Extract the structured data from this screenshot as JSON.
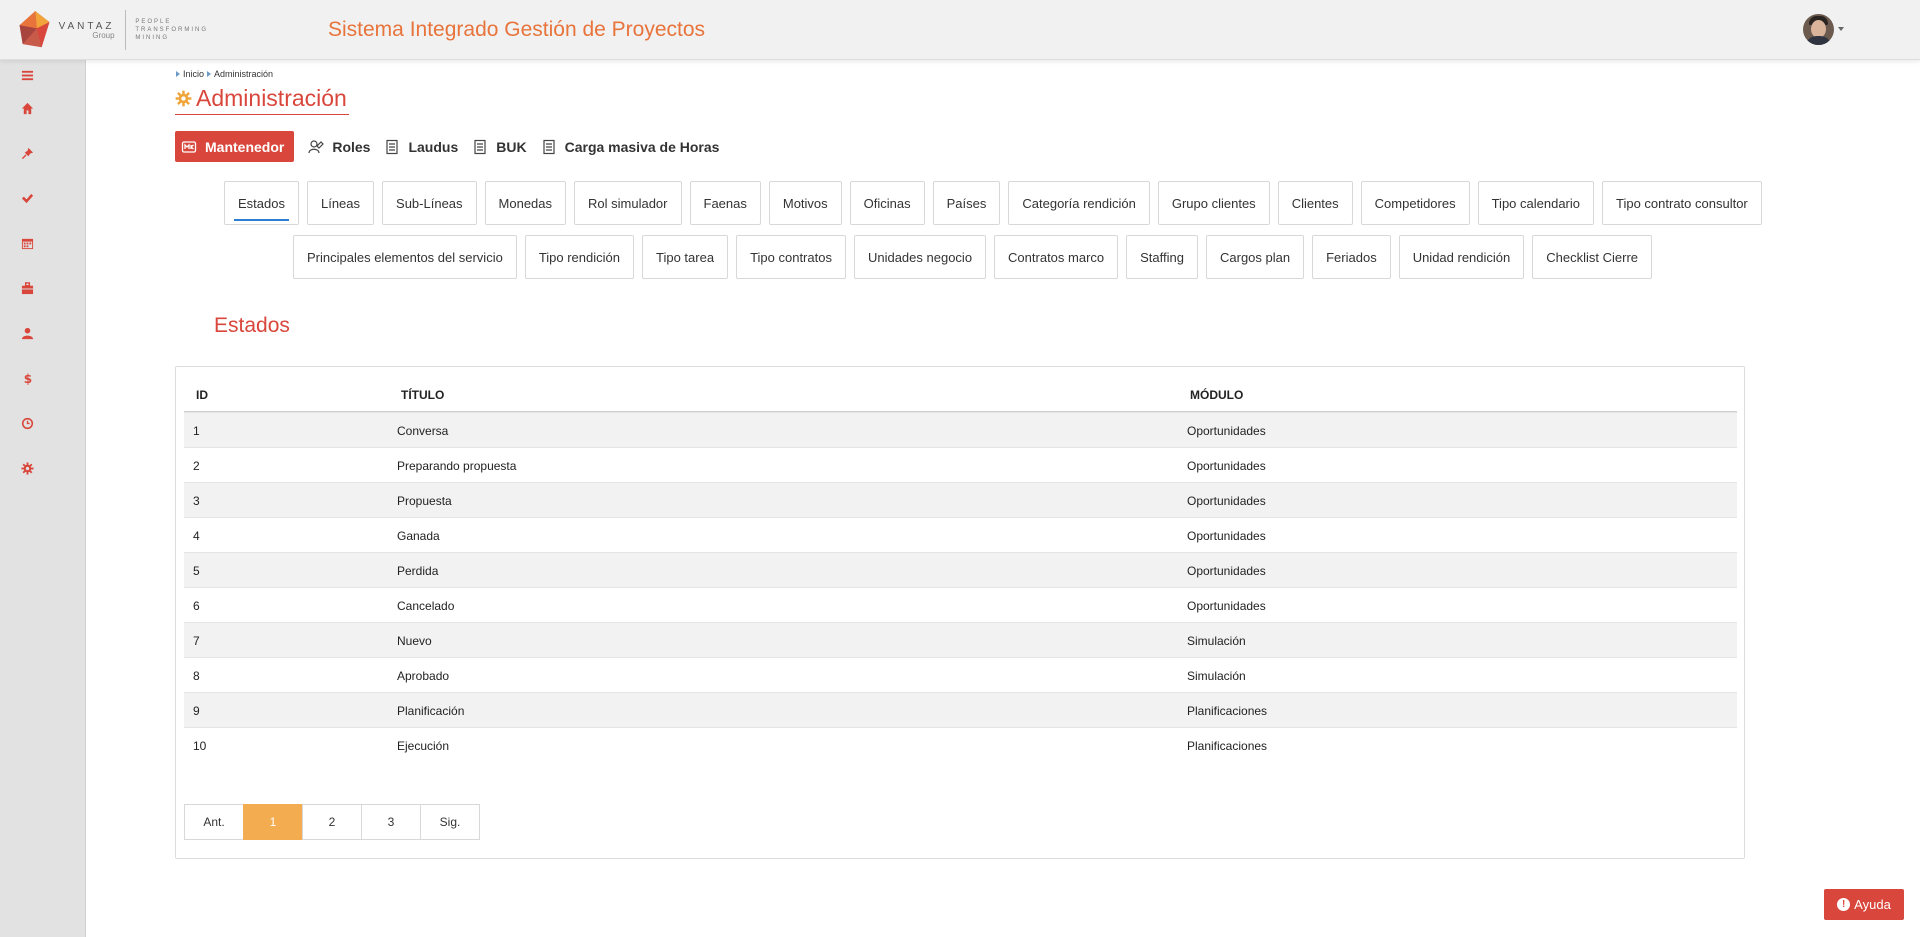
{
  "header": {
    "logo_brand": "VANTAZ",
    "logo_group": "Group",
    "logo_tagline": [
      "PEOPLE",
      "TRANSFORMING",
      "MINING"
    ],
    "app_title": "Sistema Integrado Gestión de Proyectos"
  },
  "sidebar": {
    "items": [
      {
        "icon": "menu-icon"
      },
      {
        "icon": "home-icon"
      },
      {
        "icon": "pin-icon"
      },
      {
        "icon": "check-icon"
      },
      {
        "icon": "calendar-icon"
      },
      {
        "icon": "briefcase-icon"
      },
      {
        "icon": "user-icon"
      },
      {
        "icon": "dollar-icon"
      },
      {
        "icon": "clock-icon"
      },
      {
        "icon": "gear-icon"
      }
    ]
  },
  "breadcrumb": {
    "items": [
      "Inicio",
      "Administración"
    ]
  },
  "page": {
    "title": "Administración"
  },
  "main_tabs": [
    {
      "label": "Mantenedor",
      "icon": "mantenedor-icon",
      "active": true
    },
    {
      "label": "Roles",
      "icon": "roles-icon"
    },
    {
      "label": "Laudus",
      "icon": "document-icon"
    },
    {
      "label": "BUK",
      "icon": "document-icon"
    },
    {
      "label": "Carga masiva de Horas",
      "icon": "document-icon"
    }
  ],
  "sub_tabs_row1": [
    "Estados",
    "Líneas",
    "Sub-Líneas",
    "Monedas",
    "Rol simulador",
    "Faenas",
    "Motivos",
    "Oficinas",
    "Países",
    "Categoría rendición",
    "Grupo clientes",
    "Clientes",
    "Competidores",
    "Tipo calendario",
    "Tipo contrato consultor"
  ],
  "sub_tabs_row2": [
    "Principales elementos del servicio",
    "Tipo rendición",
    "Tipo tarea",
    "Tipo contratos",
    "Unidades negocio",
    "Contratos marco",
    "Staffing",
    "Cargos plan",
    "Feriados",
    "Unidad rendición",
    "Checklist Cierre"
  ],
  "active_sub_tab": "Estados",
  "section_title": "Estados",
  "table": {
    "columns": [
      "ID",
      "TÍTULO",
      "MÓDULO"
    ],
    "rows": [
      [
        "1",
        "Conversa",
        "Oportunidades"
      ],
      [
        "2",
        "Preparando propuesta",
        "Oportunidades"
      ],
      [
        "3",
        "Propuesta",
        "Oportunidades"
      ],
      [
        "4",
        "Ganada",
        "Oportunidades"
      ],
      [
        "5",
        "Perdida",
        "Oportunidades"
      ],
      [
        "6",
        "Cancelado",
        "Oportunidades"
      ],
      [
        "7",
        "Nuevo",
        "Simulación"
      ],
      [
        "8",
        "Aprobado",
        "Simulación"
      ],
      [
        "9",
        "Planificación",
        "Planificaciones"
      ],
      [
        "10",
        "Ejecución",
        "Planificaciones"
      ]
    ]
  },
  "pagination": {
    "prev": "Ant.",
    "pages": [
      "1",
      "2",
      "3"
    ],
    "current": "1",
    "next": "Sig."
  },
  "help_button": {
    "label": "Ayuda"
  },
  "colors": {
    "accent": "#d9463b",
    "title_orange": "#e8743b",
    "pager_active": "#f3ac50"
  }
}
